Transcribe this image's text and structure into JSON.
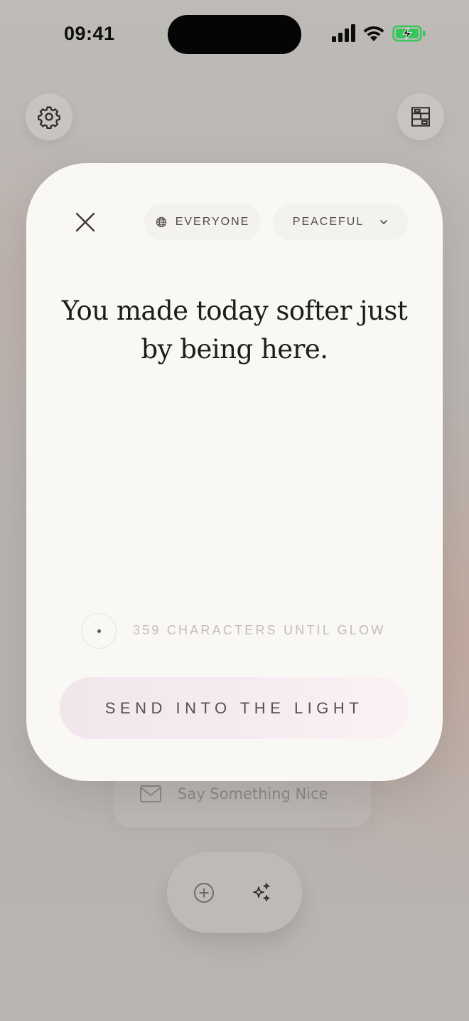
{
  "status_bar": {
    "time": "09:41",
    "icons": [
      "signal-icon",
      "wifi-icon",
      "battery-charging-icon"
    ],
    "battery_color": "#34c759"
  },
  "top_buttons": {
    "left_icon": "gear-icon",
    "right_icon": "library-icon"
  },
  "modal": {
    "audience_chip": {
      "icon": "globe-icon",
      "label": "EVERYONE"
    },
    "mood_chip": {
      "label": "PEACEFUL",
      "icon": "chevron-down-icon"
    },
    "message": "You made today softer just by being here.",
    "char_count_text": "359 CHARACTERS UNTIL GLOW",
    "send_label": "SEND INTO THE LIGHT"
  },
  "background_card": {
    "icon": "mail-icon",
    "label": "Say Something Nice"
  },
  "bottom_bar": {
    "buttons": [
      "plus-circle-icon",
      "sparkles-icon"
    ]
  }
}
